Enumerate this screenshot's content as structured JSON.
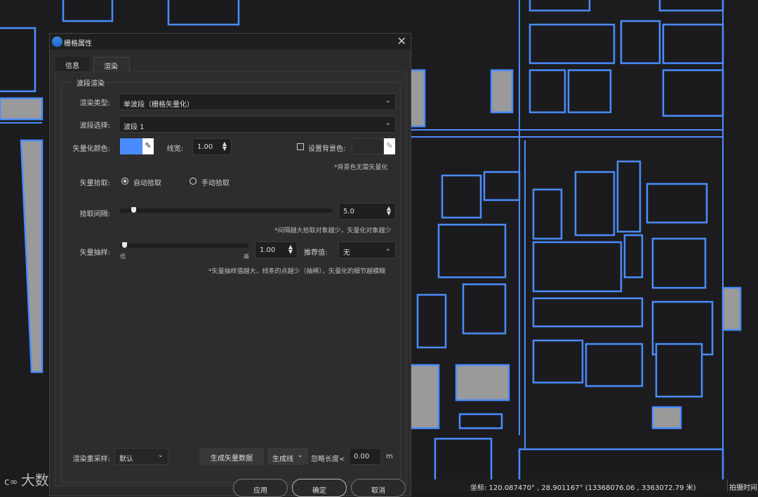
{
  "dialog": {
    "title": "栅格属性",
    "close_icon": "close-icon",
    "tabs": [
      {
        "label": "信息",
        "active": false
      },
      {
        "label": "渲染",
        "active": true
      }
    ],
    "group_title": "波段渲染",
    "render_type": {
      "label": "渲染类型:",
      "value": "单波段（栅格矢量化）"
    },
    "band_select": {
      "label": "波段选择:",
      "value": "波段 1"
    },
    "vector_color": {
      "label": "矢量化颜色:",
      "color": "#4a8cff"
    },
    "line_width": {
      "label": "线宽:",
      "value": "1.00"
    },
    "background_color": {
      "label": "设置背景色:",
      "checked": false,
      "note": "*背景色无需矢量化"
    },
    "vector_pick": {
      "label": "矢量拾取:",
      "options": [
        "自动拾取",
        "手动拾取"
      ],
      "selected": "自动拾取"
    },
    "pick_interval": {
      "label": "拾取间隔:",
      "value": "5.0",
      "note": "*间隔越大拾取对象越少，矢量化对象越少"
    },
    "vector_sampling": {
      "label": "矢量抽样:",
      "low": "低",
      "high": "高",
      "value": "1.00",
      "recommend_label": "推荐值:",
      "recommend_value": "无",
      "note": "*矢量抽样值越大，线条的点越少（抽稀），矢量化的细节越模糊"
    },
    "resample": {
      "label": "渲染重采样:",
      "value": "默认"
    },
    "generate_button": "生成矢量数据",
    "generate_type": "生成线",
    "ignore_length": {
      "label": "忽略长度<",
      "value": "0.00",
      "unit": "m"
    },
    "buttons": {
      "apply": "应用",
      "ok": "确定",
      "cancel": "取消"
    }
  },
  "statusbar": {
    "coords": "坐标:  120.087470° , 28.901167°  (13368076.06 , 3363072.79 米)",
    "capture_time": "拍摄时间"
  },
  "watermark": "大数跨境",
  "colors": {
    "outline": "#4a8cff",
    "fill": "#9a9a9a",
    "background": "#1c1c1e"
  }
}
